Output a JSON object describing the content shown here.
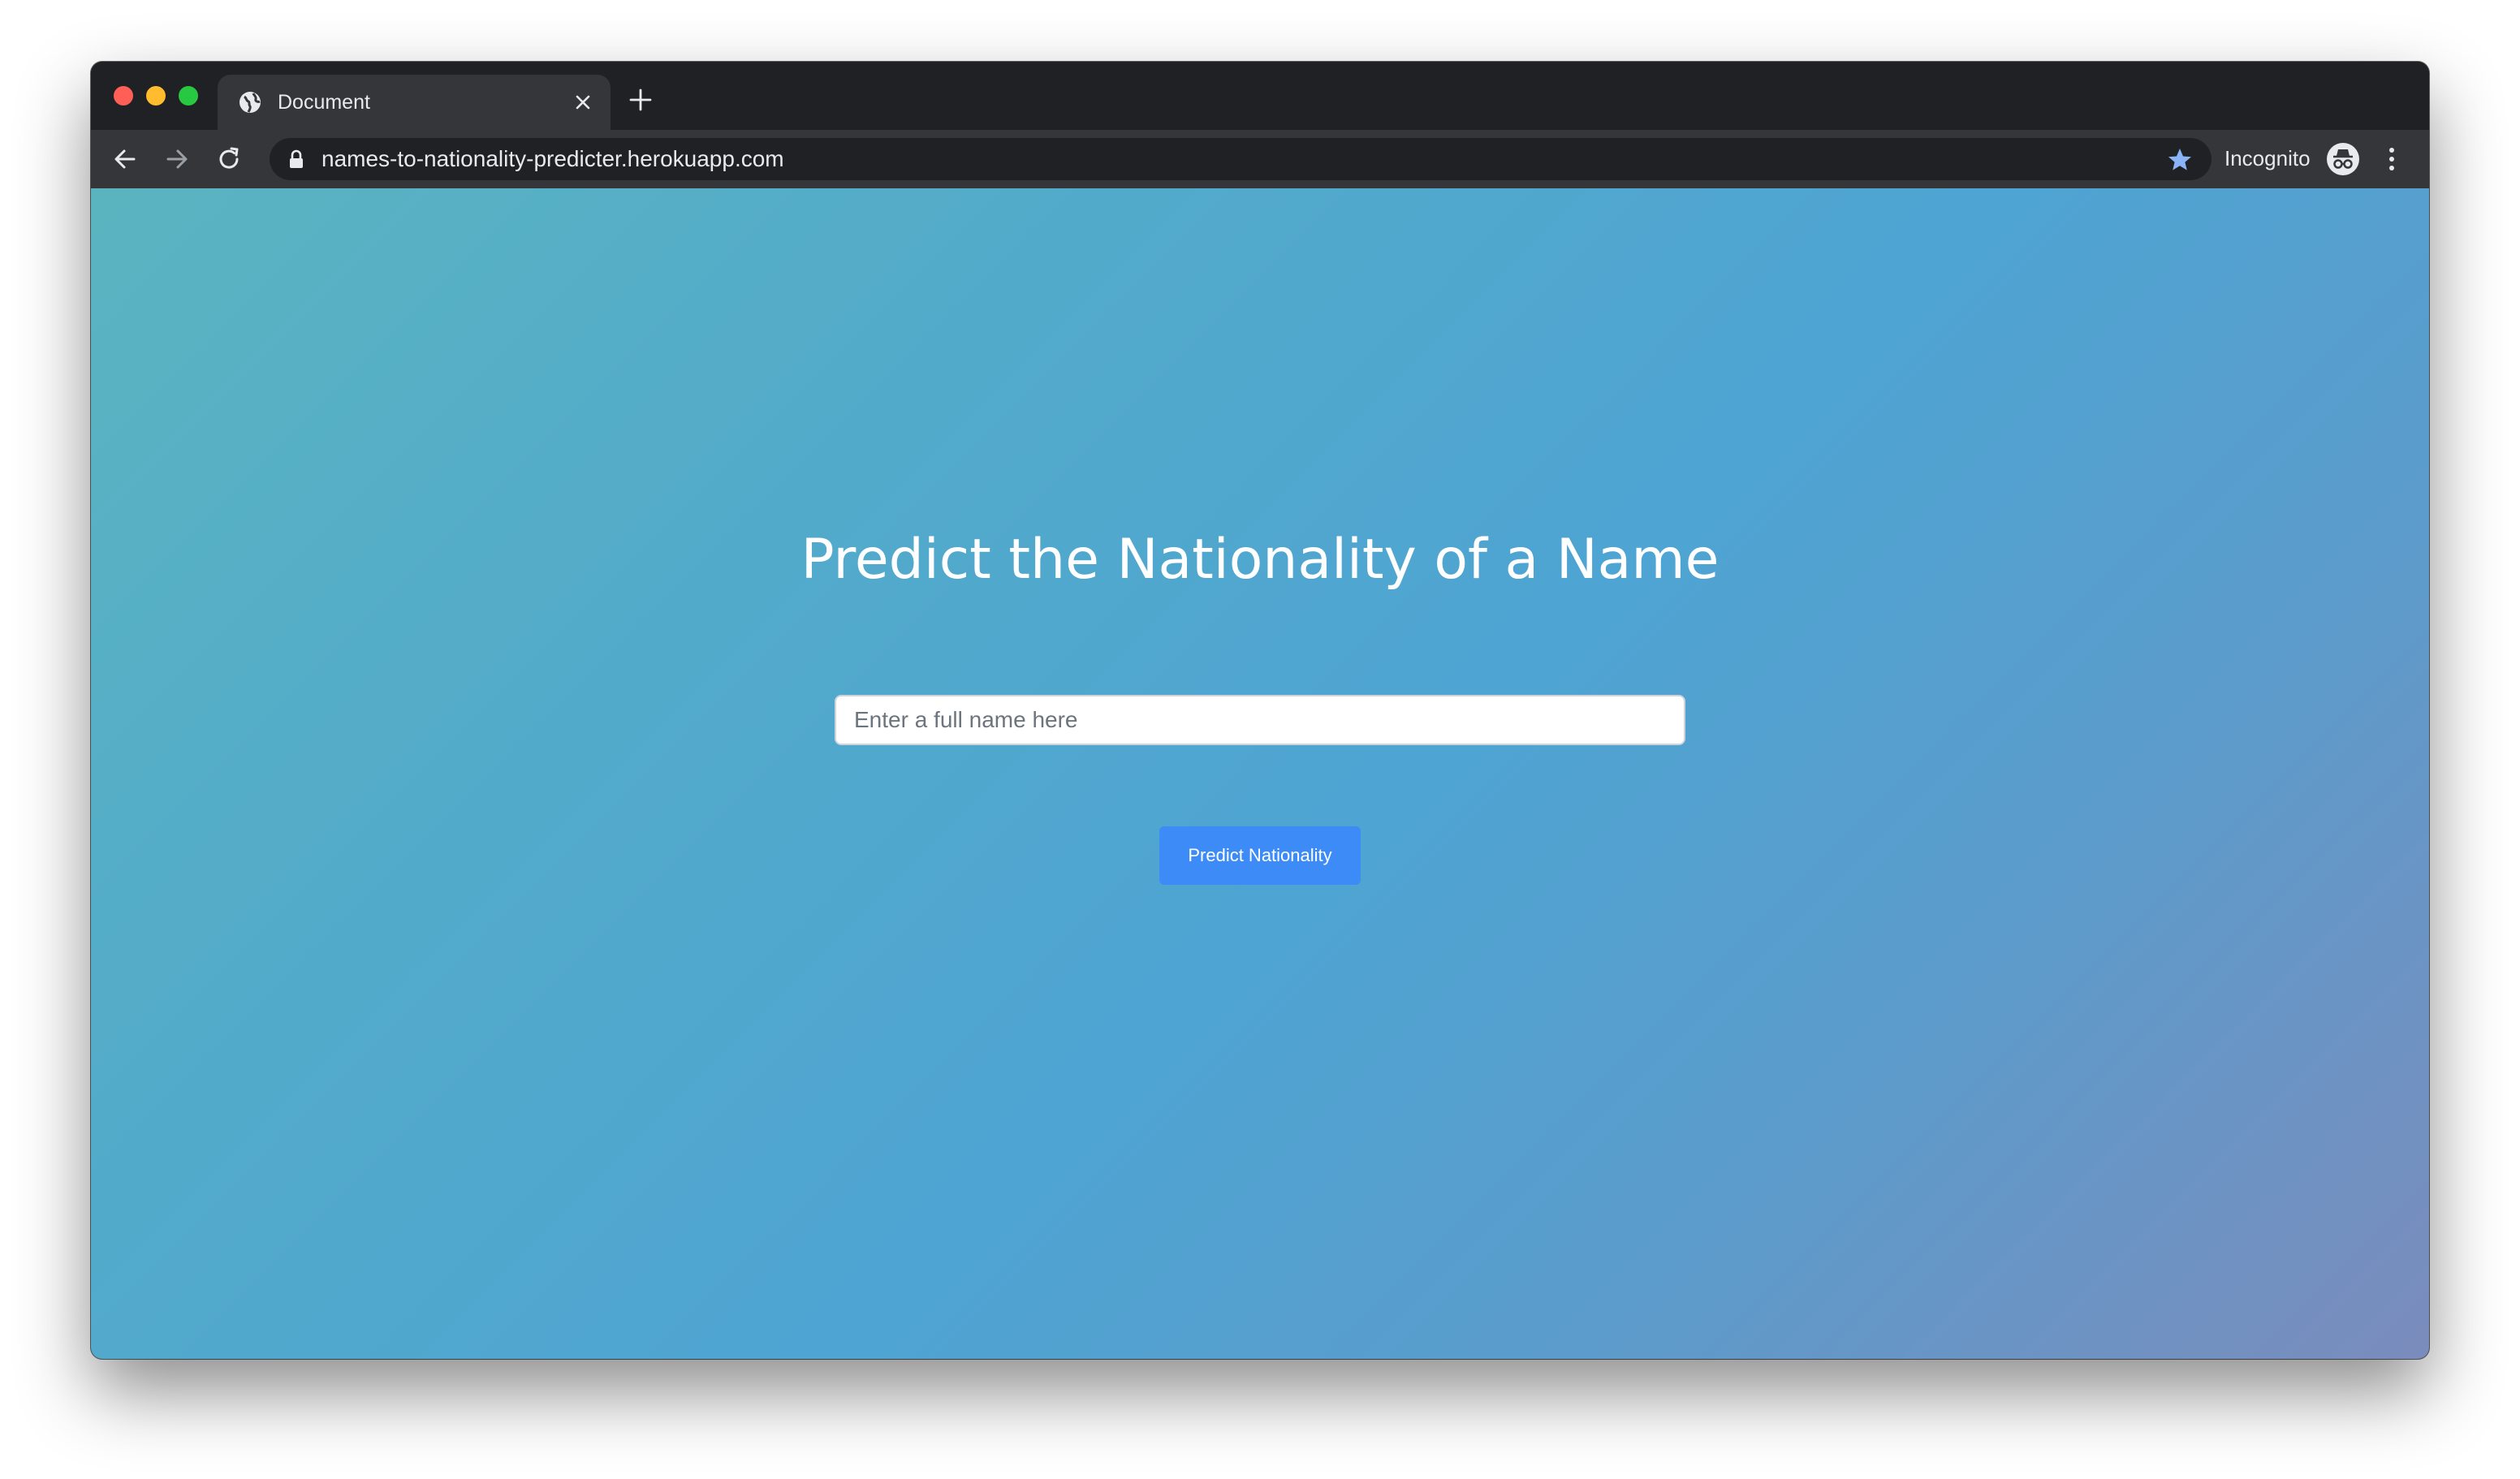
{
  "browser": {
    "tab": {
      "title": "Document",
      "favicon": "globe-icon"
    },
    "address_bar": {
      "url": "names-to-nationality-predicter.herokuapp.com",
      "bookmark_color": "#8ab4f8"
    },
    "profile": {
      "label": "Incognito"
    }
  },
  "page": {
    "title": "Predict the Nationality of a Name",
    "name_input": {
      "placeholder": "Enter a full name here",
      "value": ""
    },
    "predict_button": {
      "label": "Predict Nationality",
      "color": "#3c8bf7"
    }
  }
}
